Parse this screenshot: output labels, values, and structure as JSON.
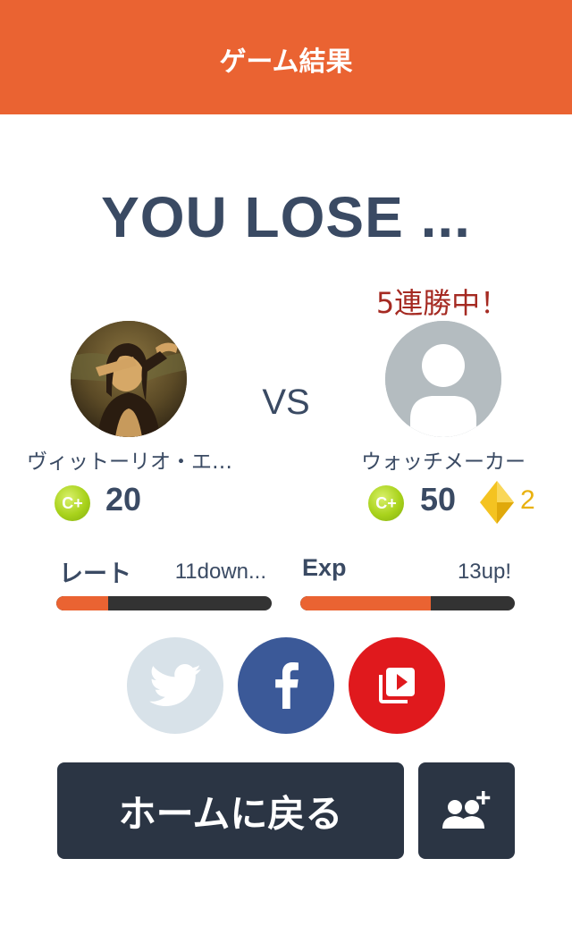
{
  "header": {
    "title": "ゲーム結果"
  },
  "result": {
    "title": "YOU LOSE ..."
  },
  "vs_label": "VS",
  "player_left": {
    "name": "ヴィットーリオ・エ…",
    "coin_icon_text": "C+",
    "score": "20"
  },
  "player_right": {
    "streak": "5連勝中！",
    "name": "ウォッチメーカー",
    "coin_icon_text": "C+",
    "score": "50",
    "gem_count": "2"
  },
  "stats": {
    "rate": {
      "label": "レート",
      "value": "11down...",
      "progress": 0.24
    },
    "exp": {
      "label": "Exp",
      "value": "13up!",
      "progress": 0.61
    }
  },
  "social": {
    "twitter_icon": "twitter-bird-icon",
    "facebook_icon": "facebook-f-icon",
    "video_icon": "video-playlist-icon"
  },
  "actions": {
    "home_label": "ホームに戻る",
    "add_friend_icon": "add-friend-icon"
  },
  "colors": {
    "accent": "#ea6332",
    "dark": "#2b3544",
    "text": "#3a4a63",
    "streak": "#a52a22",
    "gem": "#e9b10f"
  }
}
